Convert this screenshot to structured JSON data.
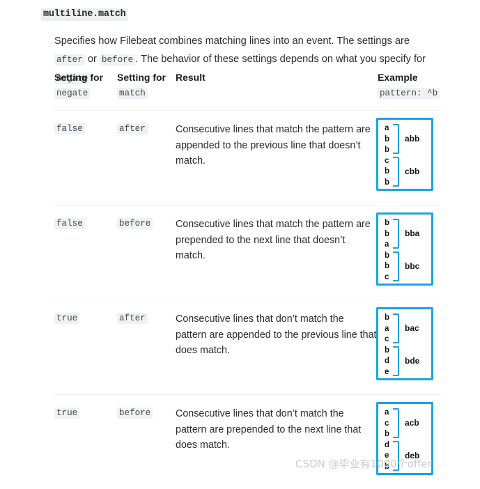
{
  "heading": "multiline.match",
  "intro": {
    "part1": "Specifies how Filebeat combines matching lines into an event. The settings are ",
    "code1": "after",
    "part2": " or ",
    "code2": "before",
    "part3": ". The behavior of these settings depends on what you specify for ",
    "code3": "negate",
    "part4": ":"
  },
  "table": {
    "headers": [
      {
        "title": "Setting for",
        "sub": "negate"
      },
      {
        "title": "Setting for",
        "sub": "match"
      },
      {
        "title": "Result",
        "sub": ""
      },
      {
        "title": "Example",
        "sub": "pattern: ^b"
      }
    ],
    "rows": [
      {
        "negate": "false",
        "match": "after",
        "result": "Consecutive lines that match the pattern are appended to the previous line that doesn’t match.",
        "example": {
          "lines": [
            "a",
            "b",
            "b",
            "c",
            "b",
            "b"
          ],
          "group1_result": "abb",
          "group2_result": "cbb"
        }
      },
      {
        "negate": "false",
        "match": "before",
        "result": "Consecutive lines that match the pattern are prepended to the next line that doesn’t match.",
        "example": {
          "lines": [
            "b",
            "b",
            "a",
            "b",
            "b",
            "c"
          ],
          "group1_result": "bba",
          "group2_result": "bbc"
        }
      },
      {
        "negate": "true",
        "match": "after",
        "result": "Consecutive lines that don’t match the pattern are appended to the previous line that does match.",
        "example": {
          "lines": [
            "b",
            "a",
            "c",
            "b",
            "d",
            "e"
          ],
          "group1_result": "bac",
          "group2_result": "bde"
        }
      },
      {
        "negate": "true",
        "match": "before",
        "result": "Consecutive lines that don’t match the pattern are prepended to the next line that does match.",
        "example": {
          "lines": [
            "a",
            "c",
            "b",
            "d",
            "e",
            "b"
          ],
          "group1_result": "acb",
          "group2_result": "deb"
        }
      }
    ]
  },
  "watermark": "CSDN @毕业有1000个offer",
  "colors": {
    "accent": "#19a3e0",
    "code_bg": "#f0f1f2",
    "divider": "#f2f0ec",
    "text": "#2b2b2b"
  }
}
